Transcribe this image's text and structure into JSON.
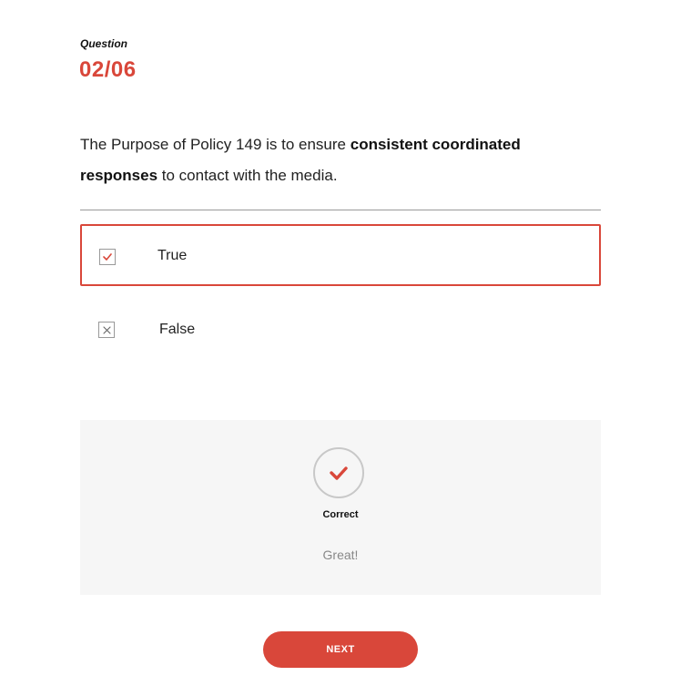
{
  "question": {
    "label": "Question",
    "number": "02/06",
    "text_before": "The Purpose of Policy 149 is to ensure ",
    "text_bold": "consistent coordinated responses",
    "text_after": " to contact with the media."
  },
  "options": [
    {
      "label": "True",
      "selected": true,
      "icon": "check-icon"
    },
    {
      "label": "False",
      "selected": false,
      "icon": "x-icon"
    }
  ],
  "feedback": {
    "icon": "check-icon",
    "title": "Correct",
    "message": "Great!"
  },
  "next_button": {
    "label": "NEXT"
  },
  "colors": {
    "accent": "#d9473a",
    "feedback_bg": "#f6f6f6"
  }
}
